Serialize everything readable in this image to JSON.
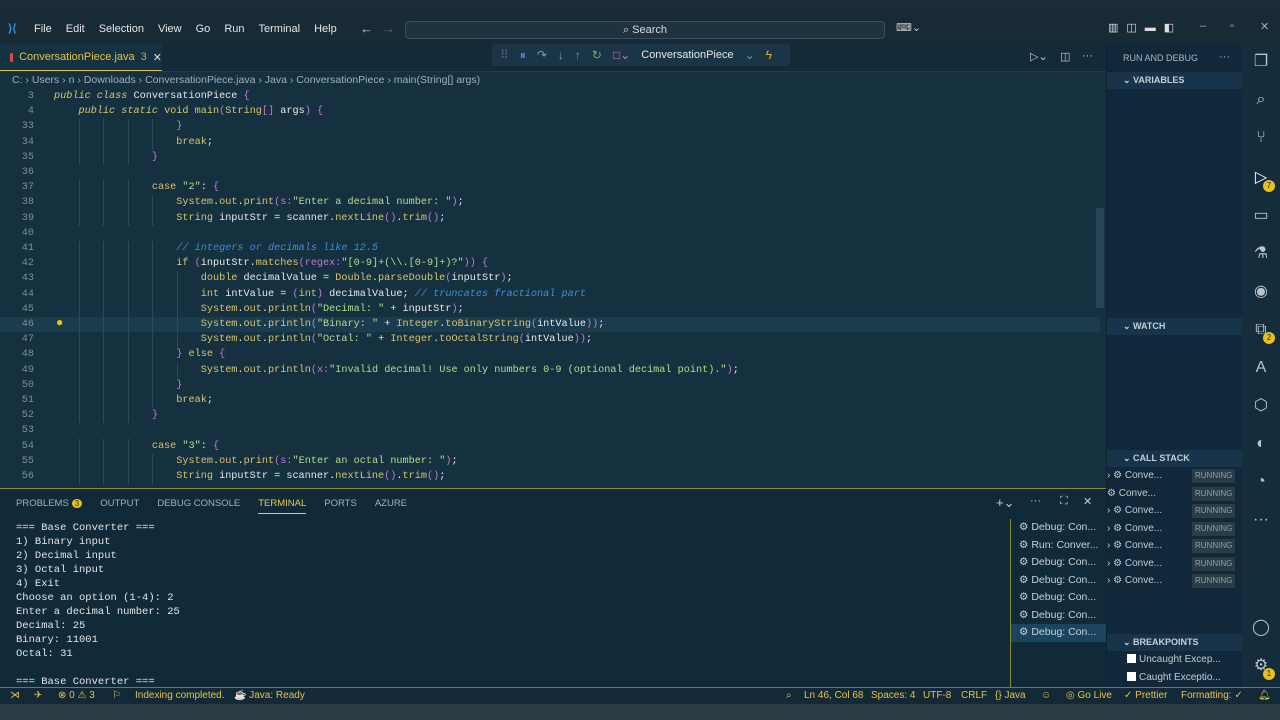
{
  "titlebar": {
    "menu": [
      "File",
      "Edit",
      "Selection",
      "View",
      "Go",
      "Run",
      "Terminal",
      "Help"
    ],
    "search": "Search"
  },
  "tab": {
    "label": "ConversationPiece.java",
    "problems": "3"
  },
  "debug": {
    "config": "ConversationPiece"
  },
  "breadcrumb": [
    "C:",
    "Users",
    "n",
    "Downloads",
    "ConversationPiece.java",
    "Java",
    "ConversationPiece",
    "main(String[] args)"
  ],
  "code": [
    {
      "n": "3",
      "i": 0,
      "t": [
        [
          "kw",
          "public class "
        ],
        [
          "nm",
          "ConversationPiece "
        ],
        [
          "br",
          "{"
        ]
      ]
    },
    {
      "n": "4",
      "i": 4,
      "t": [
        [
          "kw",
          "public static "
        ],
        [
          "kt",
          "void "
        ],
        [
          "fn",
          "main"
        ],
        [
          "br",
          "("
        ],
        [
          "ty",
          "String"
        ],
        [
          "br",
          "[]"
        ],
        [
          "nm",
          " args"
        ],
        [
          "br",
          ") {"
        ]
      ]
    },
    {
      "n": "33",
      "i": 20,
      "t": [
        [
          "br",
          "}"
        ]
      ]
    },
    {
      "n": "34",
      "i": 20,
      "t": [
        [
          "kt",
          "break"
        ],
        [
          "nm",
          ";"
        ]
      ]
    },
    {
      "n": "35",
      "i": 16,
      "t": [
        [
          "br",
          "}"
        ]
      ]
    },
    {
      "n": "36",
      "i": 0,
      "t": []
    },
    {
      "n": "37",
      "i": 16,
      "t": [
        [
          "kt",
          "case "
        ],
        [
          "st",
          "\"2\""
        ],
        [
          "nm",
          ": "
        ],
        [
          "br",
          "{"
        ]
      ]
    },
    {
      "n": "38",
      "i": 20,
      "t": [
        [
          "ty",
          "System"
        ],
        [
          "nm",
          "."
        ],
        [
          "ty",
          "out"
        ],
        [
          "nm",
          "."
        ],
        [
          "fn",
          "print"
        ],
        [
          "br",
          "("
        ],
        [
          "pm",
          "s:"
        ],
        [
          "st",
          "\"Enter a decimal number: \""
        ],
        [
          "br",
          ")"
        ],
        [
          "nm",
          ";"
        ]
      ]
    },
    {
      "n": "39",
      "i": 20,
      "t": [
        [
          "ty",
          "String "
        ],
        [
          "nm",
          "inputStr = scanner."
        ],
        [
          "fn",
          "nextLine"
        ],
        [
          "br",
          "()"
        ],
        [
          "nm",
          "."
        ],
        [
          "fn",
          "trim"
        ],
        [
          "br",
          "()"
        ],
        [
          "nm",
          ";"
        ]
      ]
    },
    {
      "n": "40",
      "i": 0,
      "t": []
    },
    {
      "n": "41",
      "i": 20,
      "t": [
        [
          "cm",
          "// integers or decimals like 12.5"
        ]
      ]
    },
    {
      "n": "42",
      "i": 20,
      "t": [
        [
          "kt",
          "if "
        ],
        [
          "br",
          "("
        ],
        [
          "nm",
          "inputStr."
        ],
        [
          "fn",
          "matches"
        ],
        [
          "br",
          "("
        ],
        [
          "pm",
          "regex:"
        ],
        [
          "st",
          "\"[0-9]+(\\\\.[0-9]+)?\""
        ],
        [
          "br",
          "))"
        ],
        [
          "nm",
          " "
        ],
        [
          "br",
          "{"
        ]
      ]
    },
    {
      "n": "43",
      "i": 24,
      "t": [
        [
          "kt",
          "double "
        ],
        [
          "nm",
          "decimalValue = "
        ],
        [
          "ty",
          "Double"
        ],
        [
          "nm",
          "."
        ],
        [
          "fn",
          "parseDouble"
        ],
        [
          "br",
          "("
        ],
        [
          "nm",
          "inputStr"
        ],
        [
          "br",
          ")"
        ],
        [
          "nm",
          ";"
        ]
      ]
    },
    {
      "n": "44",
      "i": 24,
      "t": [
        [
          "kt",
          "int "
        ],
        [
          "nm",
          "intValue = "
        ],
        [
          "br",
          "("
        ],
        [
          "kt",
          "int"
        ],
        [
          "br",
          ")"
        ],
        [
          "nm",
          " decimalValue; "
        ],
        [
          "cm",
          "// truncates fractional part"
        ]
      ]
    },
    {
      "n": "45",
      "i": 24,
      "t": [
        [
          "ty",
          "System"
        ],
        [
          "nm",
          "."
        ],
        [
          "ty",
          "out"
        ],
        [
          "nm",
          "."
        ],
        [
          "fn",
          "println"
        ],
        [
          "br",
          "("
        ],
        [
          "st",
          "\"Decimal: \""
        ],
        [
          "nm",
          " + inputStr"
        ],
        [
          "br",
          ")"
        ],
        [
          "nm",
          ";"
        ]
      ]
    },
    {
      "n": "46",
      "i": 24,
      "t": [
        [
          "ty",
          "System"
        ],
        [
          "nm",
          "."
        ],
        [
          "ty",
          "out"
        ],
        [
          "nm",
          "."
        ],
        [
          "fn",
          "println"
        ],
        [
          "br",
          "("
        ],
        [
          "st",
          "\"Binary: \""
        ],
        [
          "nm",
          " + "
        ],
        [
          "ty",
          "Integer"
        ],
        [
          "nm",
          "."
        ],
        [
          "fn",
          "toBinaryString"
        ],
        [
          "br",
          "("
        ],
        [
          "nm",
          "intValue"
        ],
        [
          "br",
          "))"
        ],
        [
          "nm",
          ";"
        ]
      ]
    },
    {
      "n": "47",
      "i": 24,
      "t": [
        [
          "ty",
          "System"
        ],
        [
          "nm",
          "."
        ],
        [
          "ty",
          "out"
        ],
        [
          "nm",
          "."
        ],
        [
          "fn",
          "println"
        ],
        [
          "br",
          "("
        ],
        [
          "st",
          "\"Octal: \""
        ],
        [
          "nm",
          " + "
        ],
        [
          "ty",
          "Integer"
        ],
        [
          "nm",
          "."
        ],
        [
          "fn",
          "toOctalString"
        ],
        [
          "br",
          "("
        ],
        [
          "nm",
          "intValue"
        ],
        [
          "br",
          "))"
        ],
        [
          "nm",
          ";"
        ]
      ]
    },
    {
      "n": "48",
      "i": 20,
      "t": [
        [
          "br",
          "} "
        ],
        [
          "kt",
          "else "
        ],
        [
          "br",
          "{"
        ]
      ]
    },
    {
      "n": "49",
      "i": 24,
      "t": [
        [
          "ty",
          "System"
        ],
        [
          "nm",
          "."
        ],
        [
          "ty",
          "out"
        ],
        [
          "nm",
          "."
        ],
        [
          "fn",
          "println"
        ],
        [
          "br",
          "("
        ],
        [
          "pm",
          "x:"
        ],
        [
          "st",
          "\"Invalid decimal! Use only numbers 0-9 (optional decimal point).\""
        ],
        [
          "br",
          ")"
        ],
        [
          "nm",
          ";"
        ]
      ]
    },
    {
      "n": "50",
      "i": 20,
      "t": [
        [
          "br",
          "}"
        ]
      ]
    },
    {
      "n": "51",
      "i": 20,
      "t": [
        [
          "kt",
          "break"
        ],
        [
          "nm",
          ";"
        ]
      ]
    },
    {
      "n": "52",
      "i": 16,
      "t": [
        [
          "br",
          "}"
        ]
      ]
    },
    {
      "n": "53",
      "i": 0,
      "t": []
    },
    {
      "n": "54",
      "i": 16,
      "t": [
        [
          "kt",
          "case "
        ],
        [
          "st",
          "\"3\""
        ],
        [
          "nm",
          ": "
        ],
        [
          "br",
          "{"
        ]
      ]
    },
    {
      "n": "55",
      "i": 20,
      "t": [
        [
          "ty",
          "System"
        ],
        [
          "nm",
          "."
        ],
        [
          "ty",
          "out"
        ],
        [
          "nm",
          "."
        ],
        [
          "fn",
          "print"
        ],
        [
          "br",
          "("
        ],
        [
          "pm",
          "s:"
        ],
        [
          "st",
          "\"Enter an octal number: \""
        ],
        [
          "br",
          ")"
        ],
        [
          "nm",
          ";"
        ]
      ]
    },
    {
      "n": "56",
      "i": 20,
      "t": [
        [
          "ty",
          "String "
        ],
        [
          "nm",
          "inputStr = scanner."
        ],
        [
          "fn",
          "nextLine"
        ],
        [
          "br",
          "()"
        ],
        [
          "nm",
          "."
        ],
        [
          "fn",
          "trim"
        ],
        [
          "br",
          "()"
        ],
        [
          "nm",
          ";"
        ]
      ]
    }
  ],
  "panel": {
    "tabs": [
      "PROBLEMS",
      "OUTPUT",
      "DEBUG CONSOLE",
      "TERMINAL",
      "PORTS",
      "AZURE"
    ],
    "problems_count": "3",
    "terminal": [
      "=== Base Converter ===",
      "1) Binary input",
      "2) Decimal input",
      "3) Octal input",
      "4) Exit",
      "Choose an option (1-4): 2",
      "Enter a decimal number: 25",
      "Decimal: 25",
      "Binary: 11001",
      "Octal: 31",
      "",
      "=== Base Converter ==="
    ],
    "terminals": [
      "Debug: Con...",
      "Run: Conver...",
      "Debug: Con...",
      "Debug: Con...",
      "Debug: Con...",
      "Debug: Con...",
      "Debug: Con..."
    ]
  },
  "sidebar": {
    "title": "RUN AND DEBUG",
    "variables": "VARIABLES",
    "watch": "WATCH",
    "callstack": "CALL STACK",
    "breakpoints": "BREAKPOINTS",
    "threads": [
      {
        "name": "Conve...",
        "state": "RUNNING"
      },
      {
        "name": "Conve...",
        "state": "RUNNING"
      },
      {
        "name": "Conve...",
        "state": "RUNNING"
      },
      {
        "name": "Conve...",
        "state": "RUNNING"
      },
      {
        "name": "Conve...",
        "state": "RUNNING"
      },
      {
        "name": "Conve...",
        "state": "RUNNING"
      },
      {
        "name": "Conve...",
        "state": "RUNNING"
      }
    ],
    "bp": [
      "Uncaught Excep...",
      "Caught Exceptio..."
    ]
  },
  "activity": {
    "debug_badge": "7",
    "extensions_badge": "2",
    "settings_badge": "1"
  },
  "status": {
    "errors": "0",
    "warnings": "3",
    "indexing": "Indexing completed.",
    "java": "Java: Ready",
    "position": "Ln 46, Col 68",
    "spaces": "Spaces: 4",
    "encoding": "UTF-8",
    "eol": "CRLF",
    "lang": "Java",
    "golive": "Go Live",
    "prettier": "Prettier",
    "formatting": "Formatting: ✓"
  }
}
